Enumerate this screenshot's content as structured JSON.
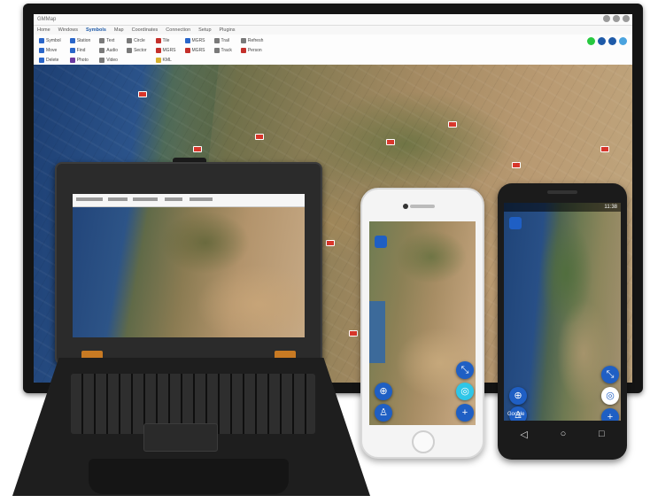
{
  "monitor": {
    "window_title": "GMMap",
    "menu": [
      "Home",
      "Windows",
      "Symbols",
      "Map",
      "Coordinates",
      "Connection",
      "Setup",
      "Plugins"
    ],
    "active_menu": "Symbols",
    "status_colors": [
      "#28c940",
      "#1e5aa8",
      "#1e5aa8",
      "#4aa3df"
    ],
    "ribbon_groups": [
      [
        {
          "label": "Symbol",
          "icon": "#2a66c9"
        },
        {
          "label": "Move",
          "icon": "#2a66c9"
        },
        {
          "label": "Delete",
          "icon": "#2a66c9"
        }
      ],
      [
        {
          "label": "Station",
          "icon": "#2a66c9"
        },
        {
          "label": "Find",
          "icon": "#2a66c9"
        },
        {
          "label": "Photo",
          "icon": "#6b3aa0"
        }
      ],
      [
        {
          "label": "Text",
          "icon": "#7a7a7a"
        },
        {
          "label": "Audio",
          "icon": "#7a7a7a"
        },
        {
          "label": "Video",
          "icon": "#7a7a7a"
        }
      ],
      [
        {
          "label": "Circle",
          "icon": "#7a7a7a"
        },
        {
          "label": "Sector",
          "icon": "#7a7a7a"
        }
      ],
      [
        {
          "label": "Tile",
          "icon": "#c4302b"
        },
        {
          "label": "MGRS",
          "icon": "#c4302b"
        },
        {
          "label": "KML",
          "icon": "#d8b22e"
        }
      ],
      [
        {
          "label": "MGRS",
          "icon": "#2a66c9"
        },
        {
          "label": "MGRS",
          "icon": "#c4302b"
        }
      ],
      [
        {
          "label": "Trail",
          "icon": "#7a7a7a"
        },
        {
          "label": "Track",
          "icon": "#7a7a7a"
        }
      ],
      [
        {
          "label": "Refresh",
          "icon": "#7a7a7a"
        },
        {
          "label": "Person",
          "icon": "#c4302b"
        }
      ]
    ]
  },
  "android": {
    "clock": "11:38",
    "map_brand": "Google"
  }
}
